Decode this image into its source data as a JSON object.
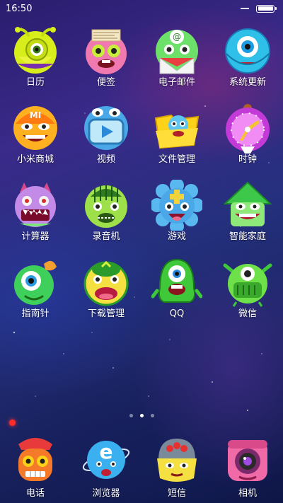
{
  "status_bar": {
    "time": "16:50",
    "battery_level": 1.0
  },
  "apps": [
    {
      "label": "日历",
      "icon": "calendar-snail-icon"
    },
    {
      "label": "便签",
      "icon": "notes-face-icon"
    },
    {
      "label": "电子邮件",
      "icon": "email-frog-icon"
    },
    {
      "label": "系统更新",
      "icon": "update-cyclops-icon"
    },
    {
      "label": "小米商城",
      "icon": "mi-store-face-icon"
    },
    {
      "label": "视频",
      "icon": "video-monster-icon"
    },
    {
      "label": "文件管理",
      "icon": "file-manager-folder-icon"
    },
    {
      "label": "时钟",
      "icon": "clock-face-icon"
    },
    {
      "label": "计算器",
      "icon": "calculator-monster-icon"
    },
    {
      "label": "录音机",
      "icon": "recorder-melon-icon"
    },
    {
      "label": "游戏",
      "icon": "game-flower-icon"
    },
    {
      "label": "智能家庭",
      "icon": "smart-home-house-icon"
    },
    {
      "label": "指南针",
      "icon": "compass-cyclops-icon"
    },
    {
      "label": "下载管理",
      "icon": "download-manager-face-icon"
    },
    {
      "label": "QQ",
      "icon": "qq-green-monster-icon"
    },
    {
      "label": "微信",
      "icon": "wechat-monster-icon"
    }
  ],
  "page_indicator": {
    "count": 3,
    "active": 1
  },
  "dock": [
    {
      "label": "电话",
      "icon": "phone-robot-icon"
    },
    {
      "label": "浏览器",
      "icon": "browser-globe-icon"
    },
    {
      "label": "短信",
      "icon": "messages-robot-icon"
    },
    {
      "label": "相机",
      "icon": "camera-face-icon"
    }
  ]
}
